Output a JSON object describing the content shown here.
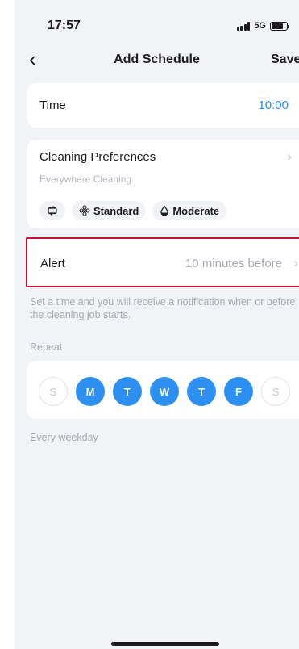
{
  "status_bar": {
    "time": "17:57",
    "network": "5G"
  },
  "nav": {
    "title": "Add Schedule",
    "save_label": "Save"
  },
  "time_row": {
    "label": "Time",
    "value": "10:00"
  },
  "preferences": {
    "title": "Cleaning Preferences",
    "subtitle": "Everywhere Cleaning",
    "chips": [
      {
        "icon": "mode-icon",
        "label": ""
      },
      {
        "icon": "fan-icon",
        "label": "Standard"
      },
      {
        "icon": "water-drop-icon",
        "label": "Moderate"
      }
    ]
  },
  "alert": {
    "label": "Alert",
    "value": "10 minutes before"
  },
  "alert_note": "Set a time and you will receive a notification when or before the cleaning job starts.",
  "repeat": {
    "label": "Repeat",
    "days": [
      {
        "label": "S",
        "selected": false
      },
      {
        "label": "M",
        "selected": true
      },
      {
        "label": "T",
        "selected": true
      },
      {
        "label": "W",
        "selected": true
      },
      {
        "label": "T",
        "selected": true
      },
      {
        "label": "F",
        "selected": true
      },
      {
        "label": "S",
        "selected": false
      }
    ],
    "summary": "Every weekday"
  },
  "colors": {
    "accent": "#2d8ff0",
    "highlight_border": "#c8102e",
    "background": "#f2f3f6"
  }
}
